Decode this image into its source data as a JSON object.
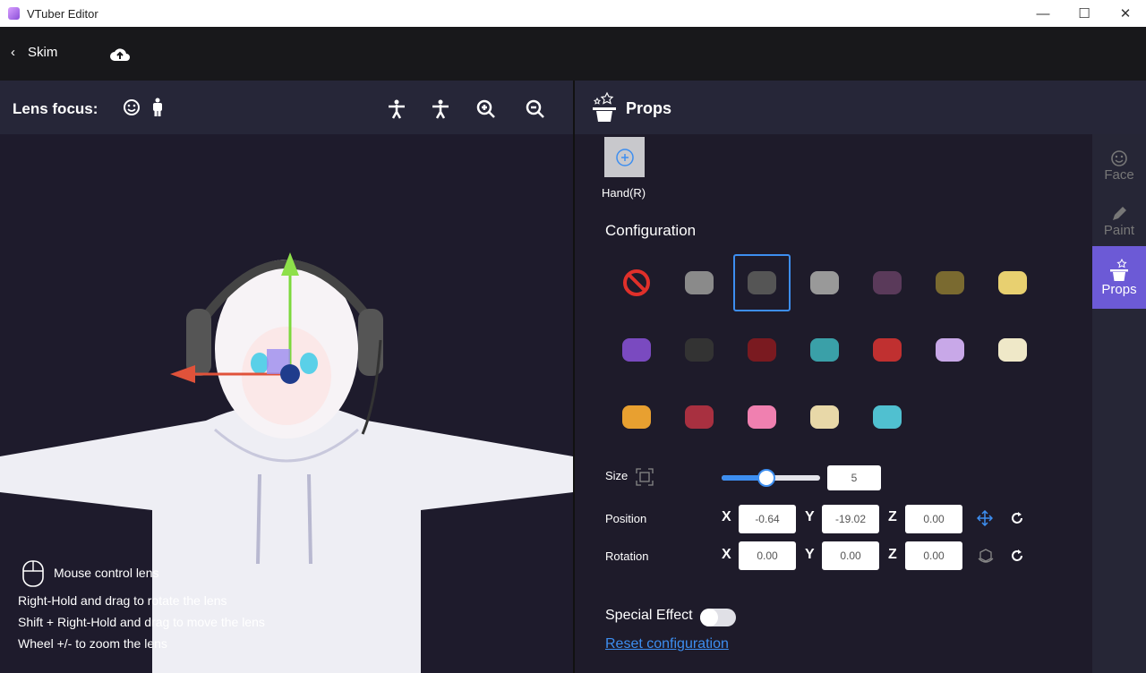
{
  "window": {
    "title": "VTuber Editor",
    "minimize": "—",
    "maximize": "☐",
    "close": "✕"
  },
  "appbar": {
    "back_label": "Skim"
  },
  "lens": {
    "title": "Lens focus:"
  },
  "viewport": {
    "hint_title": "Mouse control lens",
    "hints": [
      "Right-Hold and drag to rotate the lens",
      "Shift + Right-Hold and drag to move the lens",
      "Wheel +/- to zoom the lens"
    ]
  },
  "panel": {
    "title": "Props",
    "slot_label": "Hand(R)",
    "config_title": "Configuration",
    "props": [
      [
        "none",
        "helmet",
        "headphones",
        "horns-thin",
        "mask",
        "sunglasses",
        "crown-band"
      ],
      [
        "monster-hat",
        "wings-dark",
        "horns-red",
        "headset-teal",
        "badge",
        "butterfly",
        "unicorn"
      ],
      [
        "tv-yellow",
        "tv-red",
        "bow-pink",
        "face-mask",
        "ring-teal"
      ]
    ],
    "selected": "headphones",
    "size_label": "Size",
    "size_value": "5",
    "size_fraction": 0.45,
    "position_label": "Position",
    "rotation_label": "Rotation",
    "axes": [
      "X",
      "Y",
      "Z"
    ],
    "position": [
      "-0.64",
      "-19.02",
      "0.00"
    ],
    "rotation": [
      "0.00",
      "0.00",
      "0.00"
    ],
    "special_effect_label": "Special Effect",
    "special_effect_on": false,
    "reset_label": "Reset configuration"
  },
  "sidetabs": [
    {
      "label": "Face"
    },
    {
      "label": "Paint"
    },
    {
      "label": "Props",
      "active": true
    }
  ],
  "colors": {
    "accent": "#3d8ef0",
    "active_tab": "#6c5ad6"
  }
}
